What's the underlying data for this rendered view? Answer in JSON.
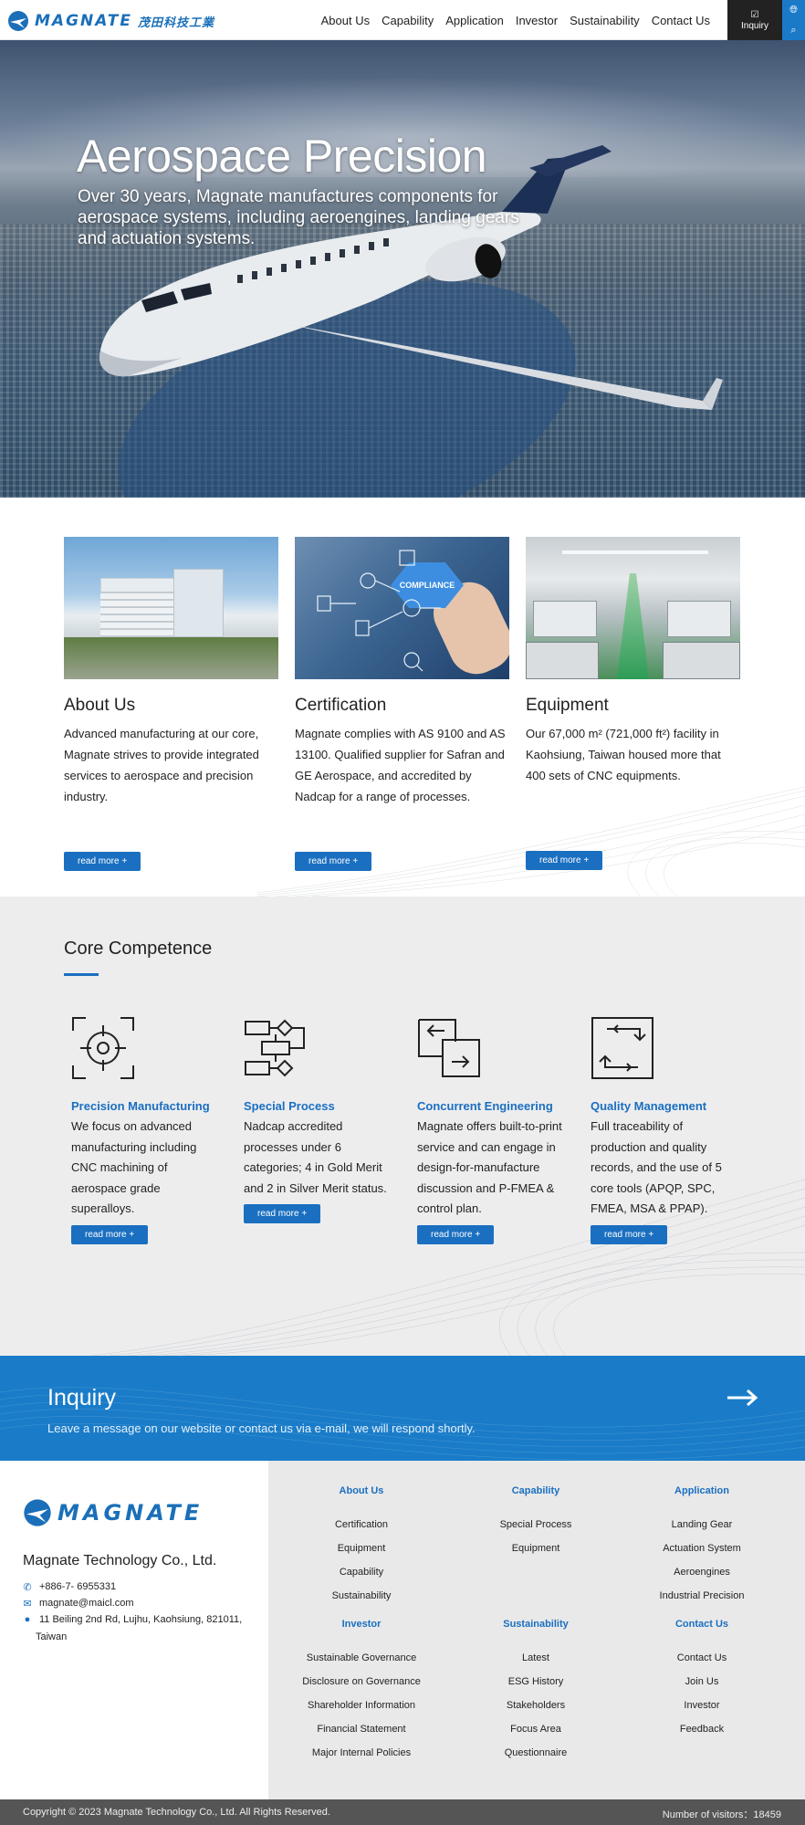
{
  "header": {
    "logo_text": "MAGNATE",
    "logo_cn": "茂田科技工業",
    "nav": [
      "About Us",
      "Capability",
      "Application",
      "Investor",
      "Sustainability",
      "Contact Us"
    ],
    "inquiry_label": "Inquiry",
    "icons": [
      "globe-icon",
      "search-icon"
    ]
  },
  "hero": {
    "title": "Aerospace Precision",
    "subtitle": "Over 30 years, Magnate manufactures components for aerospace systems, including aeroengines, landing gears and actuation systems."
  },
  "features": [
    {
      "title": "About Us",
      "text": "Advanced manufacturing at our core, Magnate strives to provide integrated services to aerospace and precision industry.",
      "button": "read more +"
    },
    {
      "title": "Certification",
      "text": "Magnate complies with AS 9100 and AS 13100. Qualified supplier for Safran and GE Aerospace, and accredited by Nadcap for a range of processes.",
      "button": "read more +",
      "badge": "COMPLIANCE"
    },
    {
      "title": "Equipment",
      "text": "Our 67,000 m² (721,000 ft²) facility in Kaohsiung, Taiwan housed more that 400 sets of CNC equipments.",
      "button": "read more +"
    }
  ],
  "core": {
    "title": "Core Competence",
    "items": [
      {
        "title": "Precision Manufacturing",
        "text": "We focus on advanced manufacturing including CNC machining of aerospace grade superalloys.",
        "button": "read more +",
        "icon": "target-icon"
      },
      {
        "title": "Special Process",
        "text": "Nadcap accredited processes under 6 categories; 4 in Gold Merit and 2 in Silver Merit status.",
        "button": "read more +",
        "icon": "flowchart-icon"
      },
      {
        "title": "Concurrent Engineering",
        "text": "Magnate offers built-to-print service and can engage in design-for-manufacture discussion and P-FMEA & control plan.",
        "button": "read more +",
        "icon": "exchange-icon"
      },
      {
        "title": "Quality Management",
        "text": "Full traceability of production and quality records, and the use of 5 core tools (APQP, SPC, FMEA, MSA & PPAP).",
        "button": "read more +",
        "icon": "cycle-icon"
      }
    ]
  },
  "inquiry": {
    "title": "Inquiry",
    "text": "Leave a message on our website or contact us via e-mail, we will respond shortly."
  },
  "footer": {
    "logo_text": "MAGNATE",
    "company": "Magnate Technology Co., Ltd.",
    "phone": "+886-7- 6955331",
    "email": "magnate@maicl.com",
    "address_line1": "11 Beiling 2nd Rd, Lujhu, Kaohsiung, 821011,",
    "address_line2": "Taiwan",
    "columns_top": [
      {
        "head": "About Us",
        "items": [
          "Certification",
          "Equipment",
          "Capability",
          "Sustainability"
        ]
      },
      {
        "head": "Capability",
        "items": [
          "Special Process",
          "Equipment"
        ]
      },
      {
        "head": "Application",
        "items": [
          "Landing Gear",
          "Actuation System",
          "Aeroengines",
          "Industrial Precision"
        ]
      }
    ],
    "columns_bottom": [
      {
        "head": "Investor",
        "items": [
          "Sustainable Governance",
          "Disclosure on Governance",
          "Shareholder Information",
          "Financial Statement",
          "Major Internal Policies"
        ]
      },
      {
        "head": "Sustainability",
        "items": [
          "Latest",
          "ESG History",
          "Stakeholders",
          "Focus Area",
          "Questionnaire"
        ]
      },
      {
        "head": "Contact Us",
        "items": [
          "Contact Us",
          "Join Us",
          "Investor",
          "Feedback"
        ]
      }
    ],
    "copyright": "Copyright © 2023 Magnate Technology Co., Ltd. All Rights Reserved.",
    "visitors": "Number of visitors：18459"
  },
  "colors": {
    "brand_blue": "#1a6fc0",
    "band_blue": "#1a7cc8",
    "dark": "#222222"
  }
}
